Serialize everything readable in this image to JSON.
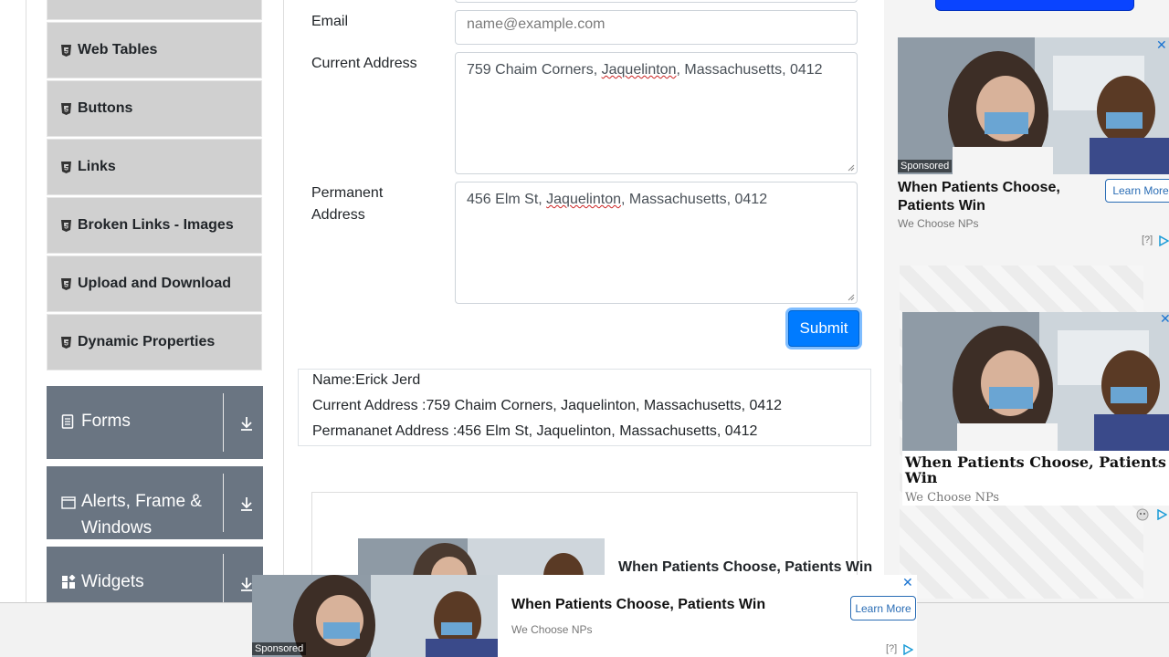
{
  "sidebar": {
    "items": [
      {
        "label": "Web Tables"
      },
      {
        "label": "Buttons"
      },
      {
        "label": "Links"
      },
      {
        "label": "Broken Links - Images"
      },
      {
        "label": "Upload and Download"
      },
      {
        "label": "Dynamic Properties"
      }
    ],
    "groups": [
      {
        "label": "Forms"
      },
      {
        "label": "Alerts, Frame &",
        "label2": "Windows"
      },
      {
        "label": "Widgets"
      }
    ]
  },
  "form": {
    "email_label": "Email",
    "email_placeholder": "name@example.com",
    "current_label": "Current Address",
    "current_value_a": "759 Chaim Corners, ",
    "current_value_u": "Jaquelinton",
    "current_value_b": ", Massachusetts, 0412",
    "permanent_label_1": "Permanent",
    "permanent_label_2": "Address",
    "permanent_value_a": "456 Elm St, ",
    "permanent_value_u": "Jaquelinton",
    "permanent_value_b": ", Massachusetts, 0412",
    "submit_label": "Submit"
  },
  "output": {
    "name": "Name:Erick Jerd",
    "current": "Current Address :759 Chaim Corners, Jaquelinton, Massachusetts, 0412",
    "permanent": "Permananet Address :456 Elm St, Jaquelinton, Massachusetts, 0412"
  },
  "ads": {
    "title": "When Patients Choose, Patients Win",
    "title_line1": "When Patients Choose,",
    "title_line2": "Patients Win",
    "serif_line1": "When Patients Choose, Patients",
    "serif_line2": "Win",
    "sponsor": "We Choose NPs",
    "sponsored": "Sponsored",
    "learn_more": "Learn More",
    "close": "✕",
    "help": "[?]"
  },
  "colors": {
    "primary": "#007bff",
    "group_bg": "#6a7582",
    "item_bg": "#d0d0d0"
  }
}
